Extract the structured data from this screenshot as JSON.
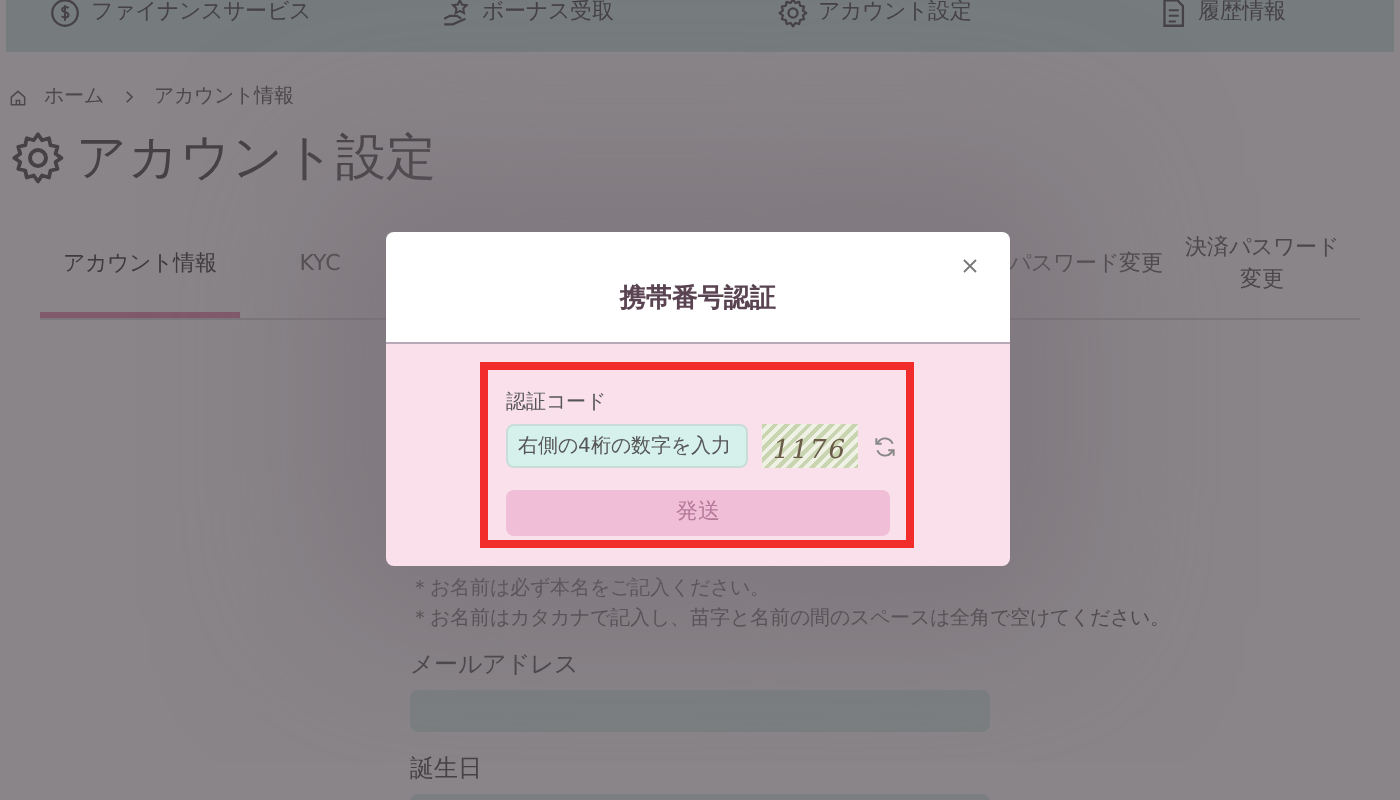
{
  "nav": [
    {
      "label": "ファイナンスサービス"
    },
    {
      "label": "ボーナス受取"
    },
    {
      "label": "アカウント設定"
    },
    {
      "label": "履歴情報"
    }
  ],
  "breadcrumb": [
    "ホーム",
    "アカウント情報"
  ],
  "page_title": "アカウント設定",
  "tabs": [
    {
      "label": "アカウント情報",
      "selected": true
    },
    {
      "label": "KYC",
      "selected": false
    },
    {
      "label": "パスワード変更",
      "selected": false
    },
    {
      "label": "決済パスワード変更",
      "selected": false
    }
  ],
  "notes": [
    "＊お名前は必ず本名をご記入ください。",
    "＊お名前はカタカナで記入し、苗字と名前の間のスペースは全角で空けてください。"
  ],
  "fields": [
    {
      "label": "メールアドレス"
    },
    {
      "label": "誕生日"
    }
  ],
  "modal": {
    "title": "携帯番号認証",
    "code_label": "認証コード",
    "placeholder": "右側の4桁の数字を入力",
    "captcha": "1176",
    "send_button": {
      "label": "発送",
      "disabled": true
    }
  }
}
